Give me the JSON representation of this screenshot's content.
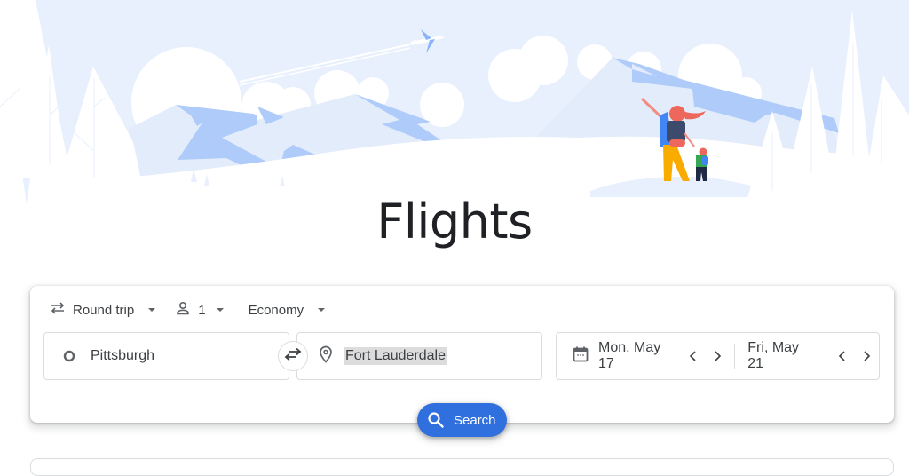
{
  "page": {
    "title": "Flights"
  },
  "hero": {
    "illustration": "mountain-landscape-with-airplane-and-hikers",
    "colors": {
      "sky": "#e8f0fe",
      "mountain": "#aecbfa",
      "snow": "#ffffff",
      "accent_blue": "#669df6"
    }
  },
  "search_form": {
    "trip_type": {
      "icon": "swap-horiz-icon",
      "label": "Round trip"
    },
    "passengers": {
      "icon": "person-icon",
      "label": "1"
    },
    "cabin_class": {
      "label": "Economy"
    },
    "origin": {
      "icon": "circle-outline-icon",
      "value": "Pittsburgh"
    },
    "swap": {
      "icon": "swap-arrows-icon"
    },
    "destination": {
      "icon": "location-pin-icon",
      "value": "Fort Lauderdale"
    },
    "departure": {
      "icon": "calendar-icon",
      "value": "Mon, May 17"
    },
    "return": {
      "value": "Fri, May 21"
    },
    "search_button": {
      "icon": "search-icon",
      "label": "Search",
      "color": "#2f6fde"
    }
  }
}
